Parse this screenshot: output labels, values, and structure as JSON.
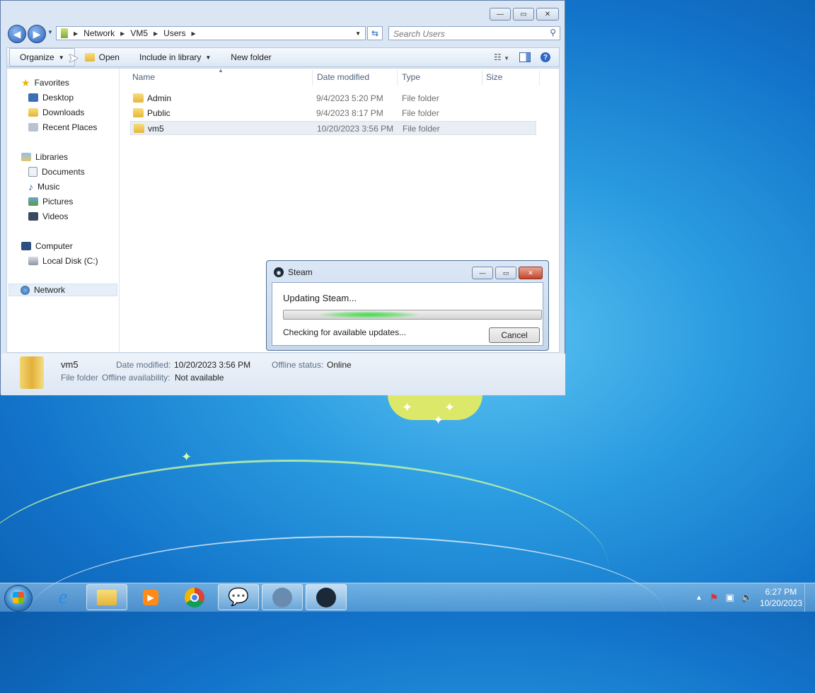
{
  "explorer": {
    "window_buttons": {
      "min": "—",
      "max": "▭",
      "close": "✕"
    },
    "breadcrumb": [
      "Network",
      "VM5",
      "Users"
    ],
    "search_placeholder": "Search Users",
    "toolbar": {
      "organize": "Organize",
      "open": "Open",
      "include": "Include in library",
      "new_folder": "New folder",
      "help": "?"
    },
    "nav": {
      "favorites": "Favorites",
      "desktop": "Desktop",
      "downloads": "Downloads",
      "recent": "Recent Places",
      "libraries": "Libraries",
      "documents": "Documents",
      "music": "Music",
      "pictures": "Pictures",
      "videos": "Videos",
      "computer": "Computer",
      "local_disk": "Local Disk (C:)",
      "network": "Network"
    },
    "columns": {
      "name": "Name",
      "date": "Date modified",
      "type": "Type",
      "size": "Size"
    },
    "rows": [
      {
        "name": "Admin",
        "date": "9/4/2023 5:20 PM",
        "type": "File folder"
      },
      {
        "name": "Public",
        "date": "9/4/2023 8:17 PM",
        "type": "File folder"
      },
      {
        "name": "vm5",
        "date": "10/20/2023 3:56 PM",
        "type": "File folder"
      }
    ],
    "details": {
      "name": "vm5",
      "kind": "File folder",
      "date_label": "Date modified:",
      "date_value": "10/20/2023 3:56 PM",
      "offline_status_label": "Offline status:",
      "offline_status_value": "Online",
      "offline_avail_label": "Offline availability:",
      "offline_avail_value": "Not available"
    }
  },
  "steam_dialog": {
    "title": "Steam",
    "heading": "Updating Steam...",
    "status": "Checking for available updates...",
    "cancel": "Cancel"
  },
  "taskbar": {
    "time": "6:27 PM",
    "date": "10/20/2023"
  }
}
